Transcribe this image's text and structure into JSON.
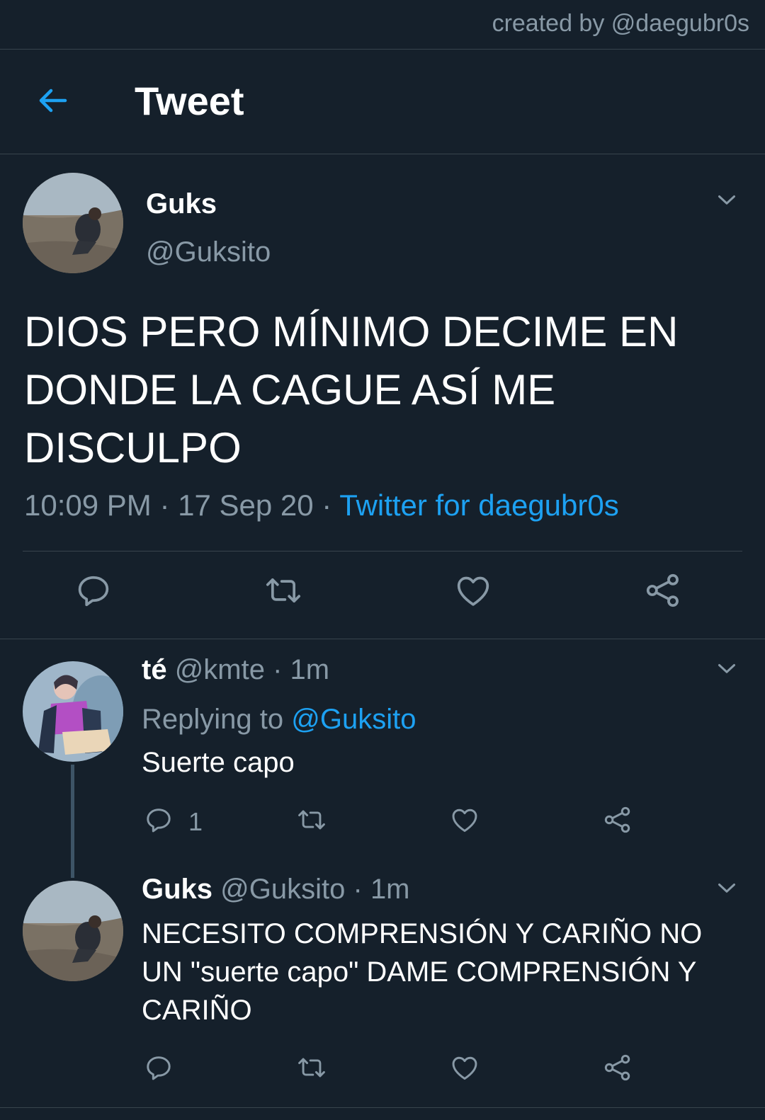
{
  "credit": "created by @daegubr0s",
  "header": {
    "title": "Tweet"
  },
  "tweet": {
    "name": "Guks",
    "handle": "@Guksito",
    "text": "DIOS PERO MÍNIMO DECIME EN DONDE LA CAGUE ASÍ ME DISCULPO",
    "time": "10:09 PM",
    "date": "17 Sep 20",
    "source": "Twitter for daegubr0s",
    "sep": " · "
  },
  "replies": [
    {
      "name": "té",
      "handle": "@kmte",
      "time": "1m",
      "replying_label": "Replying to",
      "replying_to": "@Guksito",
      "text": "Suerte capo",
      "reply_count": "1"
    },
    {
      "name": "Guks",
      "handle": "@Guksito",
      "time": "1m",
      "text": "NECESITO COMPRENSIÓN Y CARIÑO NO UN \"suerte capo\" DAME COMPRENSIÓN Y CARIÑO"
    }
  ],
  "icons": {
    "back": "arrow-left-icon",
    "reply": "speech-bubble-icon",
    "retweet": "retweet-icon",
    "like": "heart-icon",
    "share": "share-icon",
    "more": "chevron-down-icon"
  },
  "colors": {
    "background": "#15202b",
    "accent": "#1da1f2",
    "secondary_text": "#8899a6",
    "divider": "#38444d"
  }
}
